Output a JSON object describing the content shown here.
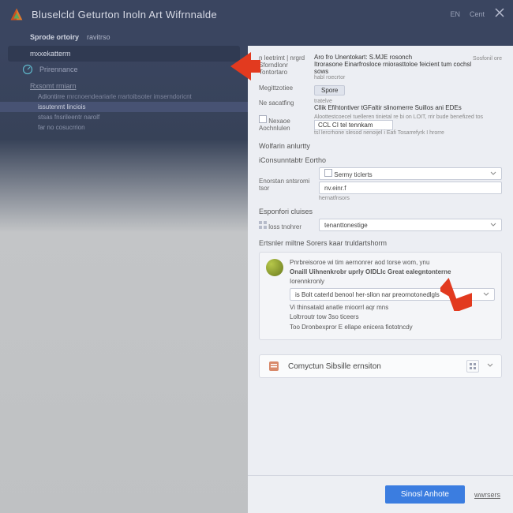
{
  "header": {
    "title": "Bluselcld Geturton Inoln Art Wifrnnalde",
    "lang": "EN",
    "cent": "Cent"
  },
  "subhead": {
    "t1": "Sprode ortoiry",
    "t2": "ravitrso"
  },
  "left": {
    "item_sel": "mxxekatterm",
    "item2": "Prirennance",
    "sect1": "Rxsomt rmiarn",
    "line1a": "Adiontirre",
    "line1b": "rnrcnoendeariarle rrartoibsoter imserndoricnt",
    "line2a": "issutenmt linciois",
    "line2b": "stsas fnsrileentr narolf",
    "line3": "far no cosucrrion"
  },
  "right": {
    "row1_lab": "n leetrimt | nrgrd Sforndlonr Tontortaro",
    "row1_a": "Aro fro Unentokart: S.MJE rosonch",
    "row1_b": "Itrorasone Einarfrosloce rniorasttoloe feicient tum cochsl sows",
    "row1_c": "habl roecrtor",
    "row1_link": "Sosfonil ore",
    "row2_lab": "Megittzotiee",
    "row2_btn": "Spore",
    "row3_lab": "Ne sacatfing",
    "row3_a": "tratelve",
    "row3_b": "Cllik Efihtontiver tGFaltir slinomerre Suillos ani EDEs",
    "row4_lab": "Nexaoe Aochnlulen",
    "row4_a": "Aloottestcoecel tuelleren tinietal re bi on LOIT, rrir bude benefized tos",
    "row4_input": "CCL CI tel tennkam",
    "row4_c": "tsl lercrhone slesod nenoijel i Eafi Tosarrefyrk I hrorre",
    "sec_a": "Wolfarin anlurtty",
    "sec_b": "iConsunntabtr Eortho",
    "field1_lab": "Enorstan sntsromi tsor",
    "field1_sel": "Sermy ticlerts",
    "field1_line": "nv.einr.f",
    "field1_note": "hernatfnsors",
    "field2_lab": "Esponfori cluises",
    "field2_sub": "loss tnohrer",
    "field2_sel": "tenanttonestige",
    "card_head": "Ertsnler miltne Sorers kaar truldartshorm",
    "card_p1": "Pnrbreisoroe wi tim aernonrer aod torse wom, ynu",
    "card_p2": "Onaill Uihnenkrobr uprly OIDLlc Great ealegntonterne",
    "card_sub1": "Iorennkronly",
    "card_sel": "is Bolt caterld benool her-sllon nar preornotonedlgls",
    "card_l1": "Vi thinsatald anatle mioorrl aqr mns",
    "card_l2": "Loltrroutr tow 3so ticeers",
    "card_l3": "Too Dronbexpror E ellape enicera fiototncdy",
    "coll_title": "Comyctun Sibsille ernsiton",
    "btn_primary": "Sinosl Anhote",
    "btn_secondary": "wwrsers"
  }
}
